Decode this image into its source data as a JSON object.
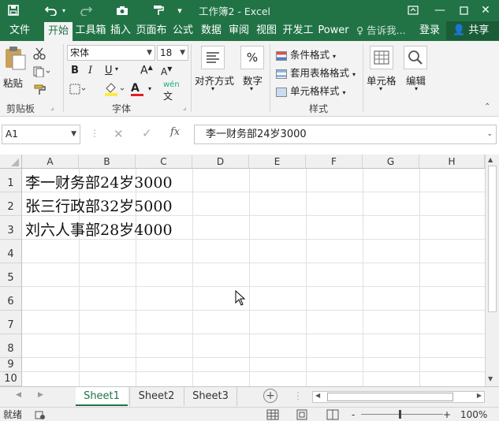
{
  "titlebar": {
    "title": "工作簿2 - Excel",
    "save_icon": "floppy-disk",
    "undo_icon": "undo-arrow",
    "redo_icon": "redo-arrow",
    "camera_icon": "camera",
    "brush_icon": "format-brush"
  },
  "tabs": {
    "file": "文件",
    "home": "开始",
    "toolbox": "工具箱",
    "insert": "插入",
    "page_layout": "页面布",
    "formulas": "公式",
    "data": "数据",
    "review": "审阅",
    "view": "视图",
    "developer": "开发工",
    "power": "Power",
    "tell_me": "告诉我...",
    "login": "登录",
    "share": "共享"
  },
  "ribbon": {
    "paste": "粘贴",
    "clipboard": "剪贴板",
    "font_name": "宋体",
    "font_size": "18",
    "font_group": "字体",
    "bold": "B",
    "italic": "I",
    "underline": "U",
    "grow_font": "A",
    "shrink_font": "A",
    "font_color": "A",
    "phonetic": "wén",
    "align": "对齐方式",
    "number": "数字",
    "percent": "%",
    "cond_format": "条件格式",
    "table_format": "套用表格格式",
    "cell_style": "单元格样式",
    "styles_group": "样式",
    "cells": "单元格",
    "editing": "编辑"
  },
  "formula_bar": {
    "name_box": "A1",
    "fx": "fx",
    "content": "李一财务部24岁3000"
  },
  "grid": {
    "columns": [
      "A",
      "B",
      "C",
      "D",
      "E",
      "F",
      "G",
      "H"
    ],
    "rows": [
      "1",
      "2",
      "3",
      "4",
      "5",
      "6",
      "7",
      "8",
      "9",
      "10"
    ],
    "cells": [
      "李一财务部24岁3000",
      "张三行政部32岁5000",
      "刘六人事部28岁4000"
    ]
  },
  "sheets": [
    "Sheet1",
    "Sheet2",
    "Sheet3"
  ],
  "status": {
    "ready": "就绪",
    "zoom": "100%",
    "minus": "-",
    "plus": "+"
  }
}
